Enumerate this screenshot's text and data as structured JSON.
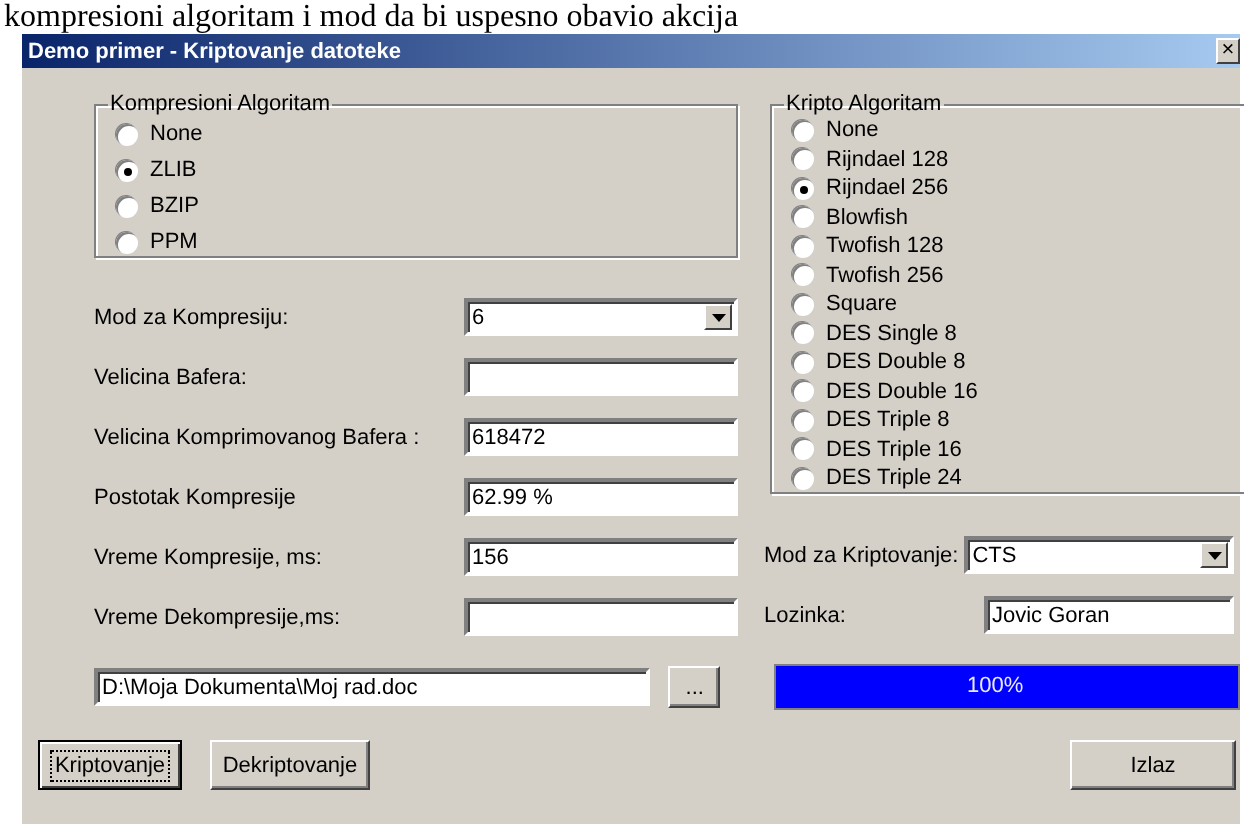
{
  "background_text": "kompresioni algoritam i mod da bi uspesno obavio akcija",
  "window": {
    "title": "Demo primer - Kriptovanje datoteke",
    "close": "×"
  },
  "compression": {
    "legend": "Kompresioni Algoritam",
    "options": [
      {
        "label": "None",
        "selected": false
      },
      {
        "label": "ZLIB",
        "selected": true
      },
      {
        "label": "BZIP",
        "selected": false
      },
      {
        "label": "PPM",
        "selected": false
      }
    ]
  },
  "compression_fields": [
    {
      "kind": "combo",
      "label": "Mod za Kompresiju:",
      "value": "6"
    },
    {
      "kind": "input",
      "label": "Velicina Bafera:"
    },
    {
      "kind": "input",
      "label": "Velicina Komprimovanog Bafera :",
      "value": "618472"
    },
    {
      "kind": "input",
      "label": "Postotak Kompresije",
      "value": "62.99 %"
    },
    {
      "kind": "input",
      "label": "Vreme Kompresije, ms:",
      "value": "156"
    },
    {
      "kind": "input",
      "label": "Vreme Dekompresije,ms:"
    }
  ],
  "crypto": {
    "legend": "Kripto Algoritam",
    "options": [
      {
        "label": "None",
        "selected": false
      },
      {
        "label": "Rijndael 128",
        "selected": false
      },
      {
        "label": "Rijndael 256",
        "selected": true
      },
      {
        "label": "Blowfish",
        "selected": false
      },
      {
        "label": "Twofish 128",
        "selected": false
      },
      {
        "label": "Twofish 256",
        "selected": false
      },
      {
        "label": "Square",
        "selected": false
      },
      {
        "label": "DES Single 8",
        "selected": false
      },
      {
        "label": "DES Double 8",
        "selected": false
      },
      {
        "label": "DES Double 16",
        "selected": false
      },
      {
        "label": "DES Triple 8",
        "selected": false
      },
      {
        "label": "DES Triple 16",
        "selected": false
      },
      {
        "label": "DES Triple 24",
        "selected": false
      }
    ]
  },
  "crypto_fields": [
    {
      "kind": "combo",
      "label": "Mod za Kriptovanje:",
      "value": "CTS"
    },
    {
      "kind": "input",
      "label": "Lozinka:",
      "value": "Jovic Goran"
    }
  ],
  "file": {
    "path": "D:\\Moja Dokumenta\\Moj rad.doc",
    "browse": "..."
  },
  "progress": {
    "level": 1,
    "text": "100%"
  },
  "buttons": [
    {
      "label": "Kriptovanje",
      "focused": true
    },
    {
      "label": "Dekriptovanje",
      "focused": false
    },
    {
      "label": "Izlaz",
      "focused": false
    }
  ]
}
